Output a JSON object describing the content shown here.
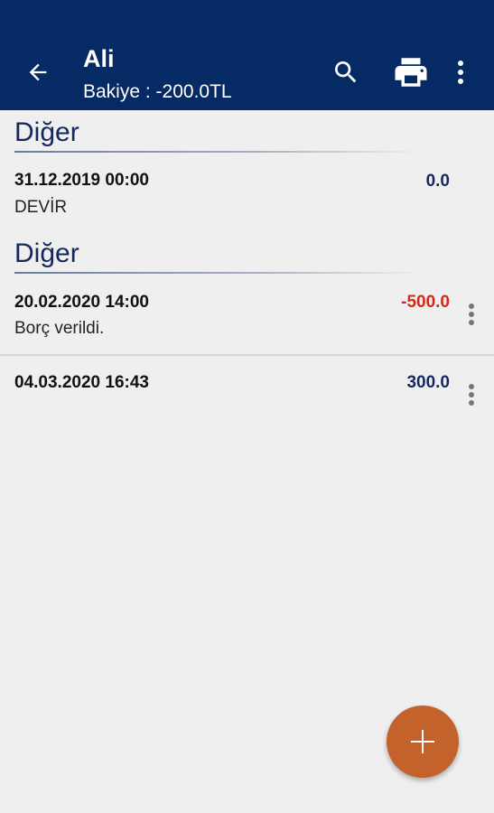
{
  "appbar": {
    "title": "Ali",
    "subtitle": "Bakiye : -200.0TL",
    "icons": [
      "back-arrow-icon",
      "search-icon",
      "print-icon",
      "more-vert-icon"
    ],
    "background": "#062a63"
  },
  "sections": [
    {
      "header": "Diğer",
      "rows": [
        {
          "date": "31.12.2019 00:00",
          "desc": "DEVİR",
          "amount": "0.0",
          "amount_color": "#17285e"
        }
      ]
    },
    {
      "header": "Diğer",
      "rows": [
        {
          "date": "20.02.2020 14:00",
          "desc": "Borç verildi.",
          "amount": "-500.0",
          "amount_color": "#d32a1a"
        },
        {
          "date": "04.03.2020 16:43",
          "desc": "",
          "amount": "300.0",
          "amount_color": "#17285e"
        }
      ]
    }
  ],
  "fab": {
    "icon": "plus-icon",
    "color": "#c4622c"
  }
}
